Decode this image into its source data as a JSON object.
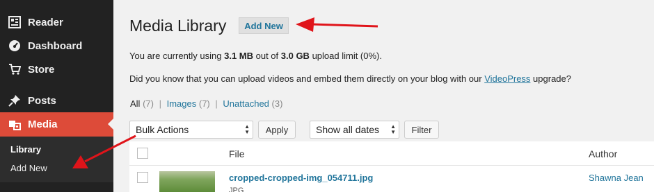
{
  "sidebar": {
    "items": [
      {
        "label": "Reader",
        "icon": "reader-icon"
      },
      {
        "label": "Dashboard",
        "icon": "dashboard-icon"
      },
      {
        "label": "Store",
        "icon": "cart-icon"
      },
      {
        "label": "Posts",
        "icon": "pushpin-icon"
      },
      {
        "label": "Media",
        "icon": "media-icon"
      }
    ],
    "submenu": [
      {
        "label": "Library"
      },
      {
        "label": "Add New"
      }
    ]
  },
  "header": {
    "title": "Media Library",
    "add_new_label": "Add New"
  },
  "notices": {
    "usage_prefix": "You are currently using ",
    "usage_used": "3.1 MB",
    "usage_middle": " out of ",
    "usage_limit": "3.0 GB",
    "usage_suffix": " upload limit (0%).",
    "video_prefix": "Did you know that you can upload videos and embed them directly on your blog with our ",
    "video_link": "VideoPress",
    "video_suffix": " upgrade?"
  },
  "filters": [
    {
      "label": "All",
      "count": "(7)"
    },
    {
      "label": "Images",
      "count": "(7)"
    },
    {
      "label": "Unattached",
      "count": "(3)"
    }
  ],
  "toolbar": {
    "bulk_actions": "Bulk Actions",
    "apply_label": "Apply",
    "dates_select": "Show all dates",
    "filter_label": "Filter"
  },
  "table": {
    "columns": {
      "file": "File",
      "author": "Author"
    },
    "rows": [
      {
        "file": "cropped-cropped-img_054711.jpg",
        "type": "JPG",
        "author": "Shawna Jean"
      }
    ]
  },
  "colors": {
    "sidebar_bg": "#222222",
    "active_menu": "#dd4b39",
    "link": "#21759b",
    "annotation_arrow": "#e0141a"
  }
}
